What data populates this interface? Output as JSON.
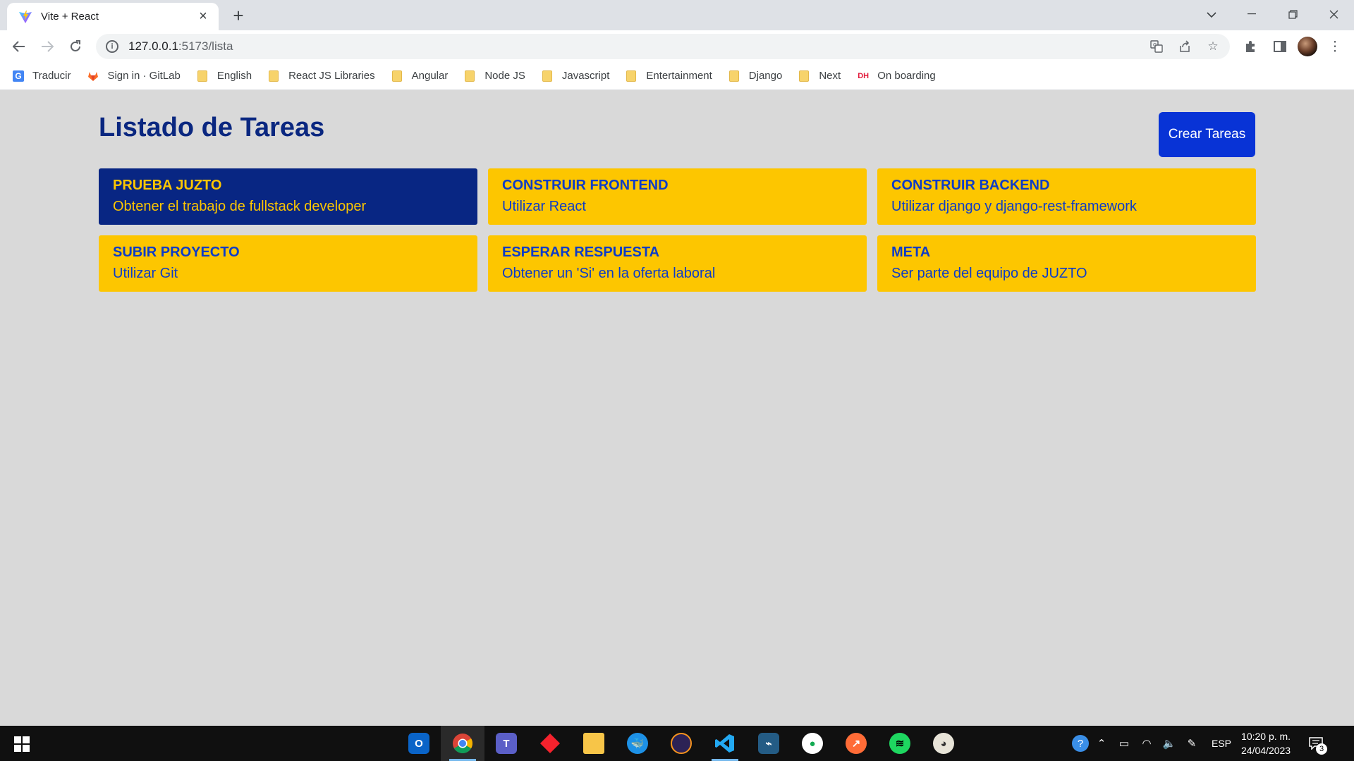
{
  "browser": {
    "tab_title": "Vite + React",
    "url_host": "127.0.0.1",
    "url_path": ":5173/lista",
    "bookmarks": [
      {
        "label": "Traducir",
        "icon": "google-translate-icon"
      },
      {
        "label": "Sign in · GitLab",
        "icon": "gitlab-icon"
      },
      {
        "label": "English",
        "icon": "folder-icon"
      },
      {
        "label": "React JS Libraries",
        "icon": "folder-icon"
      },
      {
        "label": "Angular",
        "icon": "folder-icon"
      },
      {
        "label": "Node JS",
        "icon": "folder-icon"
      },
      {
        "label": "Javascript",
        "icon": "folder-icon"
      },
      {
        "label": "Entertainment",
        "icon": "folder-icon"
      },
      {
        "label": "Django",
        "icon": "folder-icon"
      },
      {
        "label": "Next",
        "icon": "folder-icon"
      },
      {
        "label": "On boarding",
        "icon": "dh-icon"
      }
    ]
  },
  "page": {
    "title": "Listado de Tareas",
    "create_button": "Crear Tareas",
    "tasks": [
      {
        "title": "PRUEBA JUZTO",
        "description": "Obtener el trabajo de fullstack developer"
      },
      {
        "title": "CONSTRUIR FRONTEND",
        "description": "Utilizar React"
      },
      {
        "title": "CONSTRUIR BACKEND",
        "description": "Utilizar django y django-rest-framework"
      },
      {
        "title": "SUBIR PROYECTO",
        "description": "Utilizar Git"
      },
      {
        "title": "ESPERAR RESPUESTA",
        "description": "Obtener un 'Si' en la oferta laboral"
      },
      {
        "title": "META",
        "description": "Ser parte del equipo de JUZTO"
      }
    ]
  },
  "taskbar": {
    "language": "ESP",
    "time": "10:20 p. m.",
    "date": "24/04/2023",
    "notifications": "3"
  },
  "colors": {
    "page_bg": "#d9d9d9",
    "title": "#0a2780",
    "button": "#0833d6",
    "card": "#fdc600",
    "card_text": "#0d3cc8",
    "card_highlight": "#082683"
  }
}
